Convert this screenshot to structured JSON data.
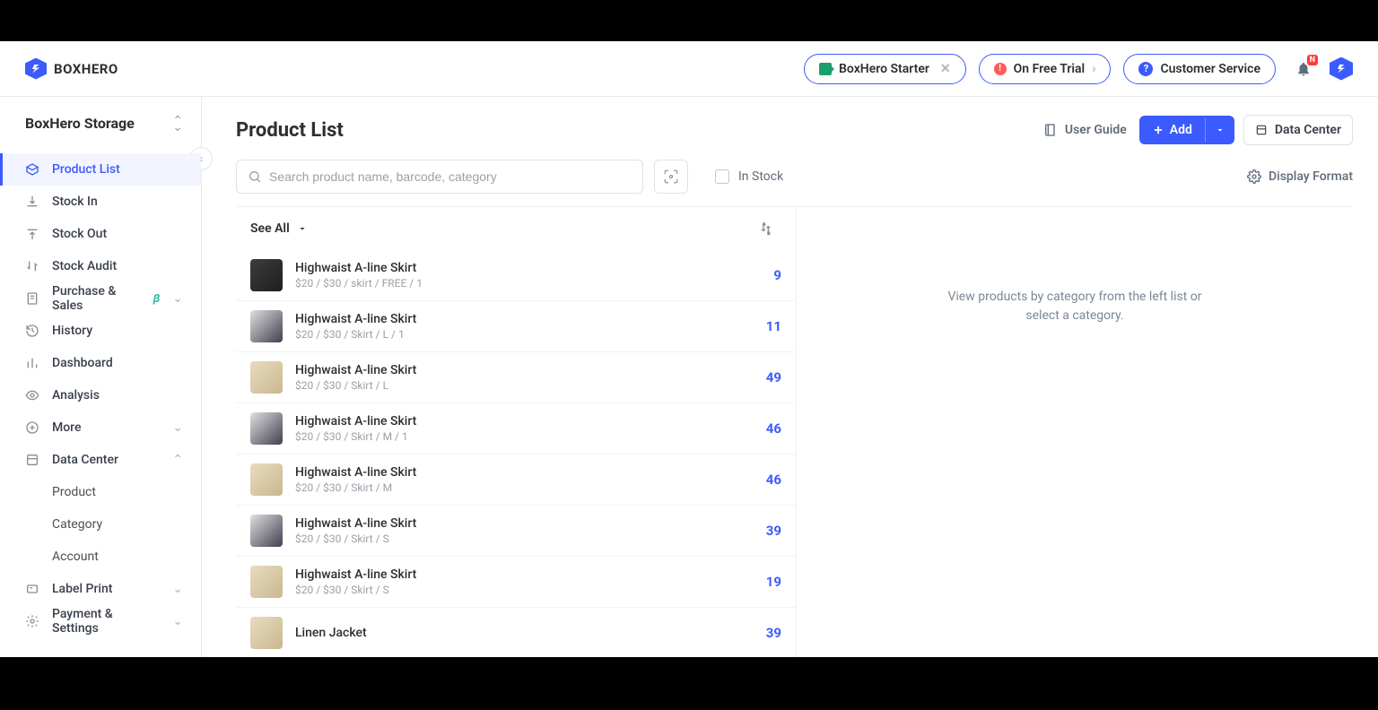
{
  "header": {
    "logo_text": "BOXHERO",
    "starter_label": "BoxHero Starter",
    "trial_label": "On Free Trial",
    "service_label": "Customer Service",
    "notif_badge": "N"
  },
  "workspace": {
    "name": "BoxHero Storage"
  },
  "sidebar": {
    "items": [
      {
        "label": "Product List",
        "icon": "box",
        "active": true
      },
      {
        "label": "Stock In",
        "icon": "download"
      },
      {
        "label": "Stock Out",
        "icon": "upload"
      },
      {
        "label": "Stock Audit",
        "icon": "swap"
      },
      {
        "label": "Purchase & Sales",
        "icon": "receipt",
        "beta": true,
        "expand": true
      },
      {
        "label": "History",
        "icon": "history"
      },
      {
        "label": "Dashboard",
        "icon": "bar"
      },
      {
        "label": "Analysis",
        "icon": "eye"
      },
      {
        "label": "More",
        "icon": "plus-circle",
        "expand": true
      },
      {
        "label": "Data Center",
        "icon": "db",
        "expand": true,
        "expanded": true,
        "children": [
          "Product",
          "Category",
          "Account"
        ]
      },
      {
        "label": "Label Print",
        "icon": "label",
        "expand": true
      },
      {
        "label": "Payment & Settings",
        "icon": "gear",
        "expand": true
      }
    ]
  },
  "page": {
    "title": "Product List",
    "user_guide": "User Guide",
    "add_label": "Add",
    "data_center": "Data Center",
    "search_placeholder": "Search product name, barcode, category",
    "instock_label": "In Stock",
    "display_format": "Display Format",
    "see_all": "See All",
    "placeholder_line1": "View products by category from the left list or",
    "placeholder_line2": "select a category."
  },
  "products": [
    {
      "name": "Highwaist A-line Skirt",
      "meta": "$20 / $30 / skirt / FREE / 1",
      "qty": 9,
      "thumb": "dark"
    },
    {
      "name": "Highwaist A-line Skirt",
      "meta": "$20 / $30 / Skirt / L / 1",
      "qty": 11,
      "thumb": "navy"
    },
    {
      "name": "Highwaist A-line Skirt",
      "meta": "$20 / $30 / Skirt / L",
      "qty": 49,
      "thumb": "cream"
    },
    {
      "name": "Highwaist A-line Skirt",
      "meta": "$20 / $30 / Skirt / M / 1",
      "qty": 46,
      "thumb": "navy"
    },
    {
      "name": "Highwaist A-line Skirt",
      "meta": "$20 / $30 / Skirt / M",
      "qty": 46,
      "thumb": "cream"
    },
    {
      "name": "Highwaist A-line Skirt",
      "meta": "$20 / $30 / Skirt / S",
      "qty": 39,
      "thumb": "navy"
    },
    {
      "name": "Highwaist A-line Skirt",
      "meta": "$20 / $30 / Skirt / S",
      "qty": 19,
      "thumb": "cream"
    },
    {
      "name": "Linen Jacket",
      "meta": "",
      "qty": 39,
      "thumb": "cream"
    }
  ]
}
